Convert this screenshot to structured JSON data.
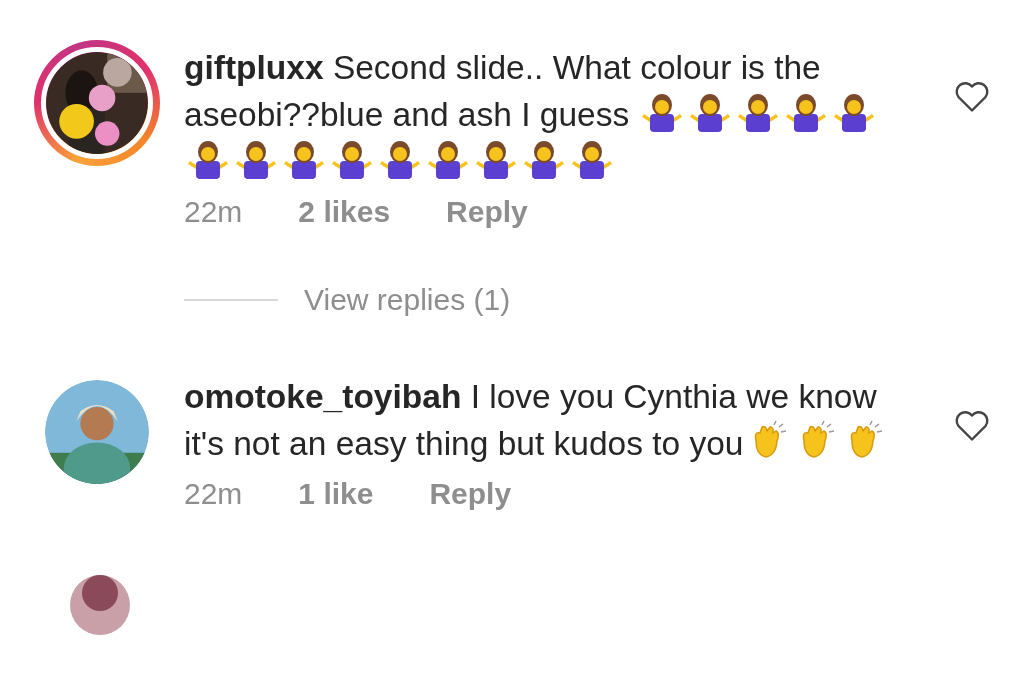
{
  "comments": [
    {
      "username": "giftpluxx",
      "story_ring": true,
      "liked": false,
      "body": [
        {
          "kind": "text",
          "text": "Second slide.. What colour is the aseobi??blue and ash I guess "
        },
        {
          "kind": "shrug"
        },
        {
          "kind": "shrug"
        },
        {
          "kind": "shrug"
        },
        {
          "kind": "shrug"
        },
        {
          "kind": "shrug"
        },
        {
          "kind": "shrug"
        },
        {
          "kind": "shrug"
        },
        {
          "kind": "shrug"
        },
        {
          "kind": "shrug"
        },
        {
          "kind": "shrug"
        },
        {
          "kind": "shrug"
        },
        {
          "kind": "shrug"
        },
        {
          "kind": "shrug"
        },
        {
          "kind": "shrug"
        }
      ],
      "time": "22m",
      "likes": "2 likes",
      "reply": "Reply",
      "view_replies": "View replies (1)"
    },
    {
      "username": "omotoke_toyibah",
      "story_ring": false,
      "liked": false,
      "body": [
        {
          "kind": "text",
          "text": "I love you Cynthia we know it's not an easy thing but kudos to you"
        },
        {
          "kind": "clap"
        },
        {
          "kind": "clap"
        },
        {
          "kind": "clap"
        }
      ],
      "time": "22m",
      "likes": "1 like",
      "reply": "Reply"
    }
  ]
}
